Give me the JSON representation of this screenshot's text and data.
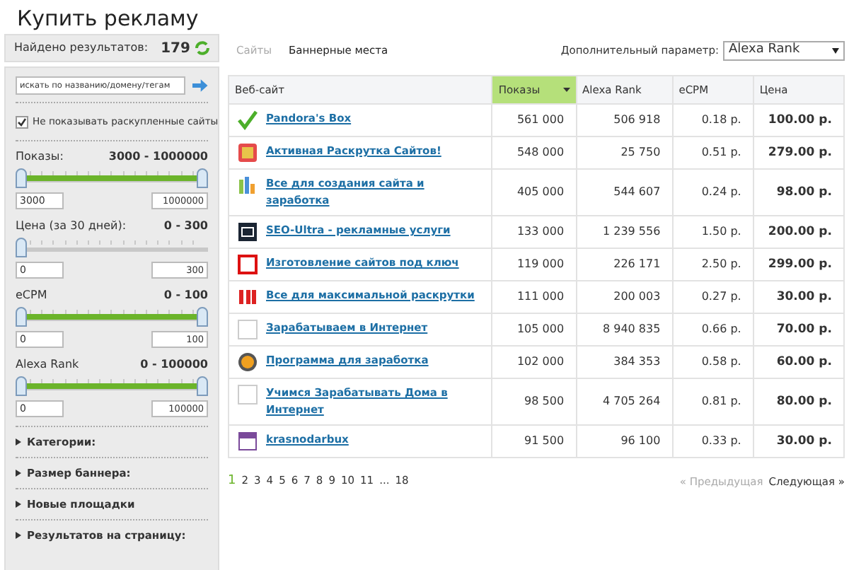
{
  "title": "Купить рекламу",
  "found": {
    "label": "Найдено результатов:",
    "count": "179"
  },
  "search": {
    "placeholder": "искать по названию/домену/тегам"
  },
  "hide_sold": {
    "label": "Не показывать раскупленные сайты",
    "checked": true
  },
  "filters": [
    {
      "label": "Показы:",
      "range": "3000 - 1000000",
      "level": 1,
      "min": "3000",
      "max": "1000000"
    },
    {
      "label": "Цена (за 30 дней):",
      "range": "0 - 300",
      "level": 0,
      "min": "0",
      "max": "300"
    },
    {
      "label": "eCPM",
      "range": "0 - 100",
      "level": 1,
      "min": "0",
      "max": "100"
    },
    {
      "label": "Alexa Rank",
      "range": "0 - 100000",
      "level": 1,
      "min": "0",
      "max": "100000"
    }
  ],
  "sections": [
    {
      "label": "Категории:",
      "expanded": false
    },
    {
      "label": "Размер баннера:",
      "expanded": false
    },
    {
      "label": "Новые площадки",
      "expanded": false
    },
    {
      "label": "Результатов на страницу:",
      "expanded": false
    }
  ],
  "tabs": [
    {
      "label": "Сайты",
      "selected": false
    },
    {
      "label": "Баннерные места",
      "selected": true
    }
  ],
  "extra_param": {
    "label": "Дополнительный параметр:",
    "value": "Alexa Rank"
  },
  "table": {
    "columns": [
      {
        "label": "Веб-сайт",
        "selected": false
      },
      {
        "label": "Показы",
        "selected": true
      },
      {
        "label": "Alexa Rank",
        "selected": false
      },
      {
        "label": "eCPM",
        "selected": false
      },
      {
        "label": "Цена",
        "selected": false
      }
    ],
    "rows": [
      {
        "kind": "check",
        "site": "Pandora's Box",
        "views": "561 000",
        "alexa": "506 918",
        "ecpm": "0.18 р.",
        "price": "100.00 р."
      },
      {
        "kind": "badge",
        "site": "Активная Раскрутка Сайтов!",
        "views": "548 000",
        "alexa": "25 750",
        "ecpm": "0.51 р.",
        "price": "279.00 р."
      },
      {
        "kind": "chart",
        "site": "Все для создания сайта и заработка",
        "views": "405 000",
        "alexa": "544 607",
        "ecpm": "0.24 р.",
        "price": "98.00 р."
      },
      {
        "kind": "dark",
        "site": "SEO-Ultra - рекламные услуги",
        "views": "133 000",
        "alexa": "1 239 556",
        "ecpm": "1.50 р.",
        "price": "200.00 р."
      },
      {
        "kind": "frame",
        "site": "Изготовление сайтов под ключ",
        "views": "119 000",
        "alexa": "226 171",
        "ecpm": "2.50 р.",
        "price": "299.00 р."
      },
      {
        "kind": "red",
        "site": "Все для максимальной раскрутки",
        "views": "111 000",
        "alexa": "200 003",
        "ecpm": "0.27 р.",
        "price": "30.00 р."
      },
      {
        "kind": "blank",
        "site": "Зарабатываем в Интернет",
        "views": "105 000",
        "alexa": "8 940 835",
        "ecpm": "0.66 р.",
        "price": "70.00 р."
      },
      {
        "kind": "coin",
        "site": "Программа для заработка",
        "views": "102 000",
        "alexa": "384 353",
        "ecpm": "0.58 р.",
        "price": "60.00 р."
      },
      {
        "kind": "blank",
        "site": "Учимся Зарабатывать Дома в Интернет",
        "views": "98 500",
        "alexa": "4 705 264",
        "ecpm": "0.81 р.",
        "price": "80.00 р."
      },
      {
        "kind": "calendar",
        "site": "krasnodarbux",
        "views": "91 500",
        "alexa": "96 100",
        "ecpm": "0.33 р.",
        "price": "30.00 р."
      }
    ]
  },
  "pagination": {
    "pages": [
      {
        "label": "1",
        "selected": true
      },
      {
        "label": "2",
        "selected": false
      },
      {
        "label": "3",
        "selected": false
      },
      {
        "label": "4",
        "selected": false
      },
      {
        "label": "5",
        "selected": false
      },
      {
        "label": "6",
        "selected": false
      },
      {
        "label": "7",
        "selected": false
      },
      {
        "label": "8",
        "selected": false
      },
      {
        "label": "9",
        "selected": false
      },
      {
        "label": "10",
        "selected": false
      },
      {
        "label": "11",
        "selected": false
      },
      {
        "label": "...",
        "selected": false
      },
      {
        "label": "18",
        "selected": false
      }
    ],
    "prev": {
      "label": "« Предыдущая",
      "disabled": true
    },
    "next": {
      "label": "Следующая »",
      "disabled": false
    }
  }
}
